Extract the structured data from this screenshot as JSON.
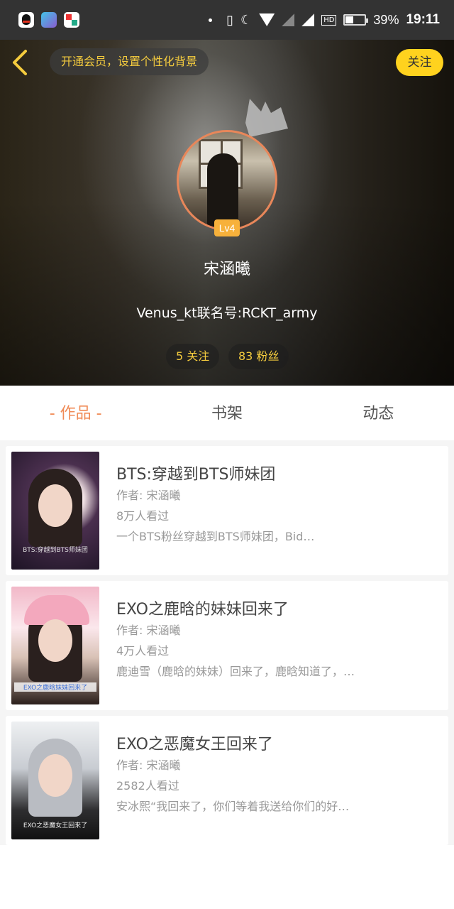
{
  "status_bar": {
    "battery": "39%",
    "time": "19:11",
    "icons": [
      "qq-icon",
      "app-icon",
      "app-icon",
      "vibrate-icon",
      "moon-icon",
      "wifi-icon",
      "signal-icon",
      "hd-icon",
      "battery-icon"
    ]
  },
  "header": {
    "vip_prompt": "开通会员，设置个性化背景",
    "follow_label": "关注"
  },
  "profile": {
    "level": "Lv4",
    "name": "宋涵曦",
    "description": "Venus_kt联名号:RCKT_army",
    "following": "5 关注",
    "fans": "83 粉丝"
  },
  "tabs": [
    {
      "label": "- 作品 -",
      "active": true
    },
    {
      "label": "书架",
      "active": false
    },
    {
      "label": "动态",
      "active": false
    }
  ],
  "works": [
    {
      "title": "BTS:穿越到BTS师妹团",
      "author": "作者: 宋涵曦",
      "views": "8万人看过",
      "desc": "一个BTS粉丝穿越到BTS师妹团，Bid…",
      "cover_caption": "BTS:穿越到BTS师妹团"
    },
    {
      "title": "EXO之鹿晗的妹妹回来了",
      "author": "作者: 宋涵曦",
      "views": "4万人看过",
      "desc": "鹿迪雪（鹿晗的妹妹）回来了，鹿晗知道了，…",
      "cover_caption": "EXO之鹿晗妹妹回来了"
    },
    {
      "title": "EXO之恶魔女王回来了",
      "author": "作者: 宋涵曦",
      "views": "2582人看过",
      "desc": "安冰熙“我回来了，你们等着我送给你们的好…",
      "cover_caption": "EXO之恶魔女王回来了"
    }
  ],
  "colors": {
    "accent": "#f08a55",
    "gold": "#f5cc3e",
    "follow_button": "#ffd21e",
    "level_badge": "#f7b13b"
  }
}
